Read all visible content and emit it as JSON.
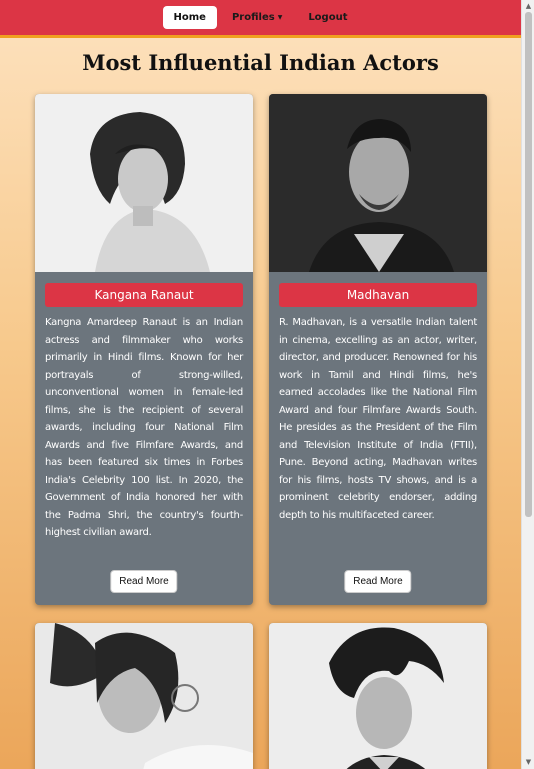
{
  "nav": {
    "home": "Home",
    "profiles": "Profiles",
    "logout": "Logout"
  },
  "page": {
    "title": "Most Influential Indian Actors"
  },
  "cards": [
    {
      "name": "Kangana Ranaut",
      "bio": "Kangna Amardeep Ranaut is an Indian actress and filmmaker who works primarily in Hindi films. Known for her portrayals of strong-willed, unconventional women in female-led films, she is the recipient of several awards, including four National Film Awards and five Filmfare Awards, and has been featured six times in Forbes India's Celebrity 100 list. In 2020, the Government of India honored her with the Padma Shri, the country's fourth-highest civilian award.",
      "button": "Read More"
    },
    {
      "name": "Madhavan",
      "bio": "R. Madhavan, is a versatile Indian talent in cinema, excelling as an actor, writer, director, and producer. Renowned for his work in Tamil and Hindi films, he's earned accolades like the National Film Award and four Filmfare Awards South. He presides as the President of the Film and Television Institute of India (FTII), Pune. Beyond acting, Madhavan writes for his films, hosts TV shows, and is a prominent celebrity endorser, adding depth to his multifaceted career.",
      "button": "Read More"
    }
  ],
  "colors": {
    "navbar": "#dc3545",
    "accent_border": "#f0a020",
    "card": "#6c757d",
    "name_badge": "#dc3545"
  }
}
